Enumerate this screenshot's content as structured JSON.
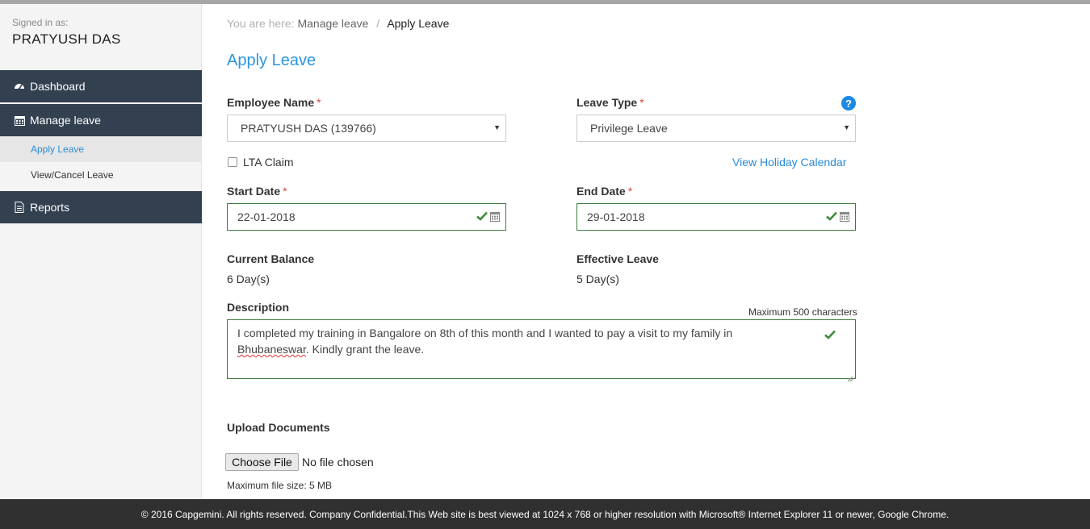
{
  "user": {
    "signed_in_label": "Signed in as:",
    "name": "PRATYUSH DAS"
  },
  "sidebar": {
    "items": [
      {
        "label": "Dashboard",
        "icon": "dashboard-icon"
      },
      {
        "label": "Manage leave",
        "icon": "calendar-icon"
      },
      {
        "label": "Reports",
        "icon": "document-icon"
      }
    ],
    "subitems": [
      {
        "label": "Apply Leave",
        "active": true
      },
      {
        "label": "View/Cancel Leave",
        "active": false
      }
    ]
  },
  "breadcrumb": {
    "prefix": "You are here:",
    "parent": "Manage leave",
    "separator": "/",
    "current": "Apply Leave"
  },
  "page_title": "Apply Leave",
  "form": {
    "employee_name": {
      "label": "Employee Name",
      "required_mark": "*",
      "value": "PRATYUSH DAS (139766)"
    },
    "leave_type": {
      "label": "Leave Type",
      "required_mark": "*",
      "value": "Privilege Leave",
      "help_icon": "?"
    },
    "lta_claim": {
      "label": "LTA Claim",
      "checked": false
    },
    "holiday_link": "View Holiday Calendar",
    "start_date": {
      "label": "Start Date",
      "required_mark": "*",
      "value": "22-01-2018"
    },
    "end_date": {
      "label": "End Date",
      "required_mark": "*",
      "value": "29-01-2018"
    },
    "current_balance": {
      "label": "Current Balance",
      "value": "6 Day(s)"
    },
    "effective_leave": {
      "label": "Effective Leave",
      "value": "5 Day(s)"
    },
    "description": {
      "label": "Description",
      "hint": "Maximum 500 characters",
      "text_before": "I completed my training in Bangalore on 8th of this month and I wanted to pay a visit to my family in ",
      "text_misspelled": "Bhubaneswar",
      "text_after": ". Kindly grant the leave."
    },
    "upload": {
      "label": "Upload Documents",
      "button": "Choose File",
      "status": "No file chosen",
      "hint": "Maximum file size: 5 MB"
    }
  },
  "footer": "© 2016 Capgemini. All rights reserved. Company Confidential.This Web site is best viewed at 1024 x 768 or higher resolution with Microsoft® Internet Explorer 11 or newer, Google Chrome.",
  "colors": {
    "nav_bg": "#334050",
    "accent": "#2b95e0",
    "valid_border": "#3c7a3c",
    "required": "#e0443a",
    "footer_bg": "#303030"
  }
}
